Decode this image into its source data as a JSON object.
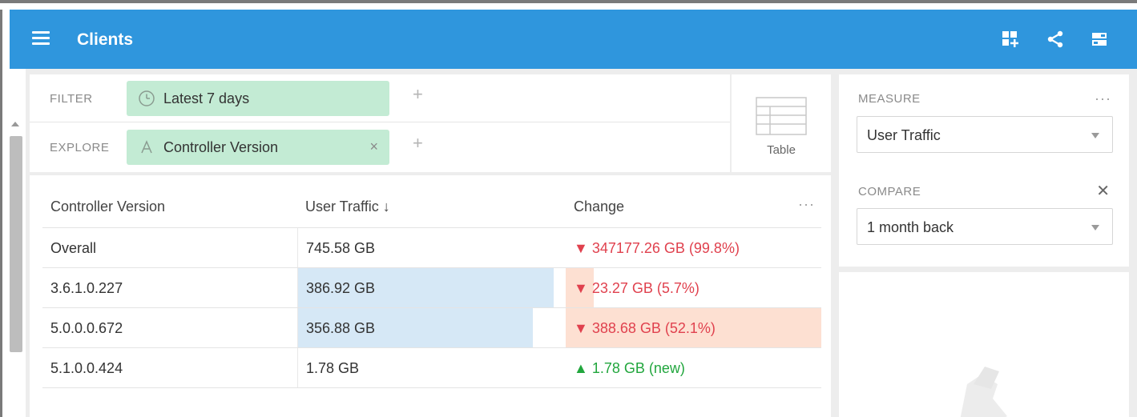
{
  "app": {
    "title": "Clients",
    "icons": [
      "menu-icon",
      "add-tile-icon",
      "share-icon",
      "layout-icon"
    ],
    "accent_color": "#2f96dd"
  },
  "filter_bar": {
    "filter_label": "FILTER",
    "filter_value": "Latest 7 days",
    "filter_icon": "clock-icon",
    "explore_label": "EXPLORE",
    "explore_value": "Controller Version",
    "explore_icon": "dimension-A-icon",
    "plus": "+",
    "close": "×"
  },
  "view_switcher": {
    "label": "Table",
    "icon": "table-icon"
  },
  "table": {
    "columns": [
      "Controller Version",
      "User Traffic ↓",
      "Change"
    ],
    "more": "···",
    "rows": [
      {
        "version": "Overall",
        "traffic": "745.58 GB",
        "change": "▼ 347177.26 GB (99.8%)",
        "direction": "down",
        "traffic_fraction": 0,
        "change_fraction": 0
      },
      {
        "version": "3.6.1.0.227",
        "traffic": "386.92 GB",
        "change": "▼ 23.27 GB (5.7%)",
        "direction": "down",
        "traffic_fraction": 1.0,
        "change_fraction": 0.11
      },
      {
        "version": "5.0.0.0.672",
        "traffic": "356.88 GB",
        "change": "▼ 388.68 GB (52.1%)",
        "direction": "down",
        "traffic_fraction": 0.92,
        "change_fraction": 1.0
      },
      {
        "version": "5.1.0.0.424",
        "traffic": "1.78 GB",
        "change": "▲ 1.78 GB (new)",
        "direction": "up",
        "traffic_fraction": 0.0,
        "change_fraction": 0
      }
    ],
    "colors": {
      "down": "#e0414e",
      "up": "#21a63d",
      "traffic_bar": "#d6e8f6",
      "change_bar": "#fde0d2"
    }
  },
  "side_panel": {
    "measure_label": "MEASURE",
    "measure_value": "User Traffic",
    "compare_label": "COMPARE",
    "compare_value": "1 month back",
    "more": "···",
    "close": "✕"
  }
}
